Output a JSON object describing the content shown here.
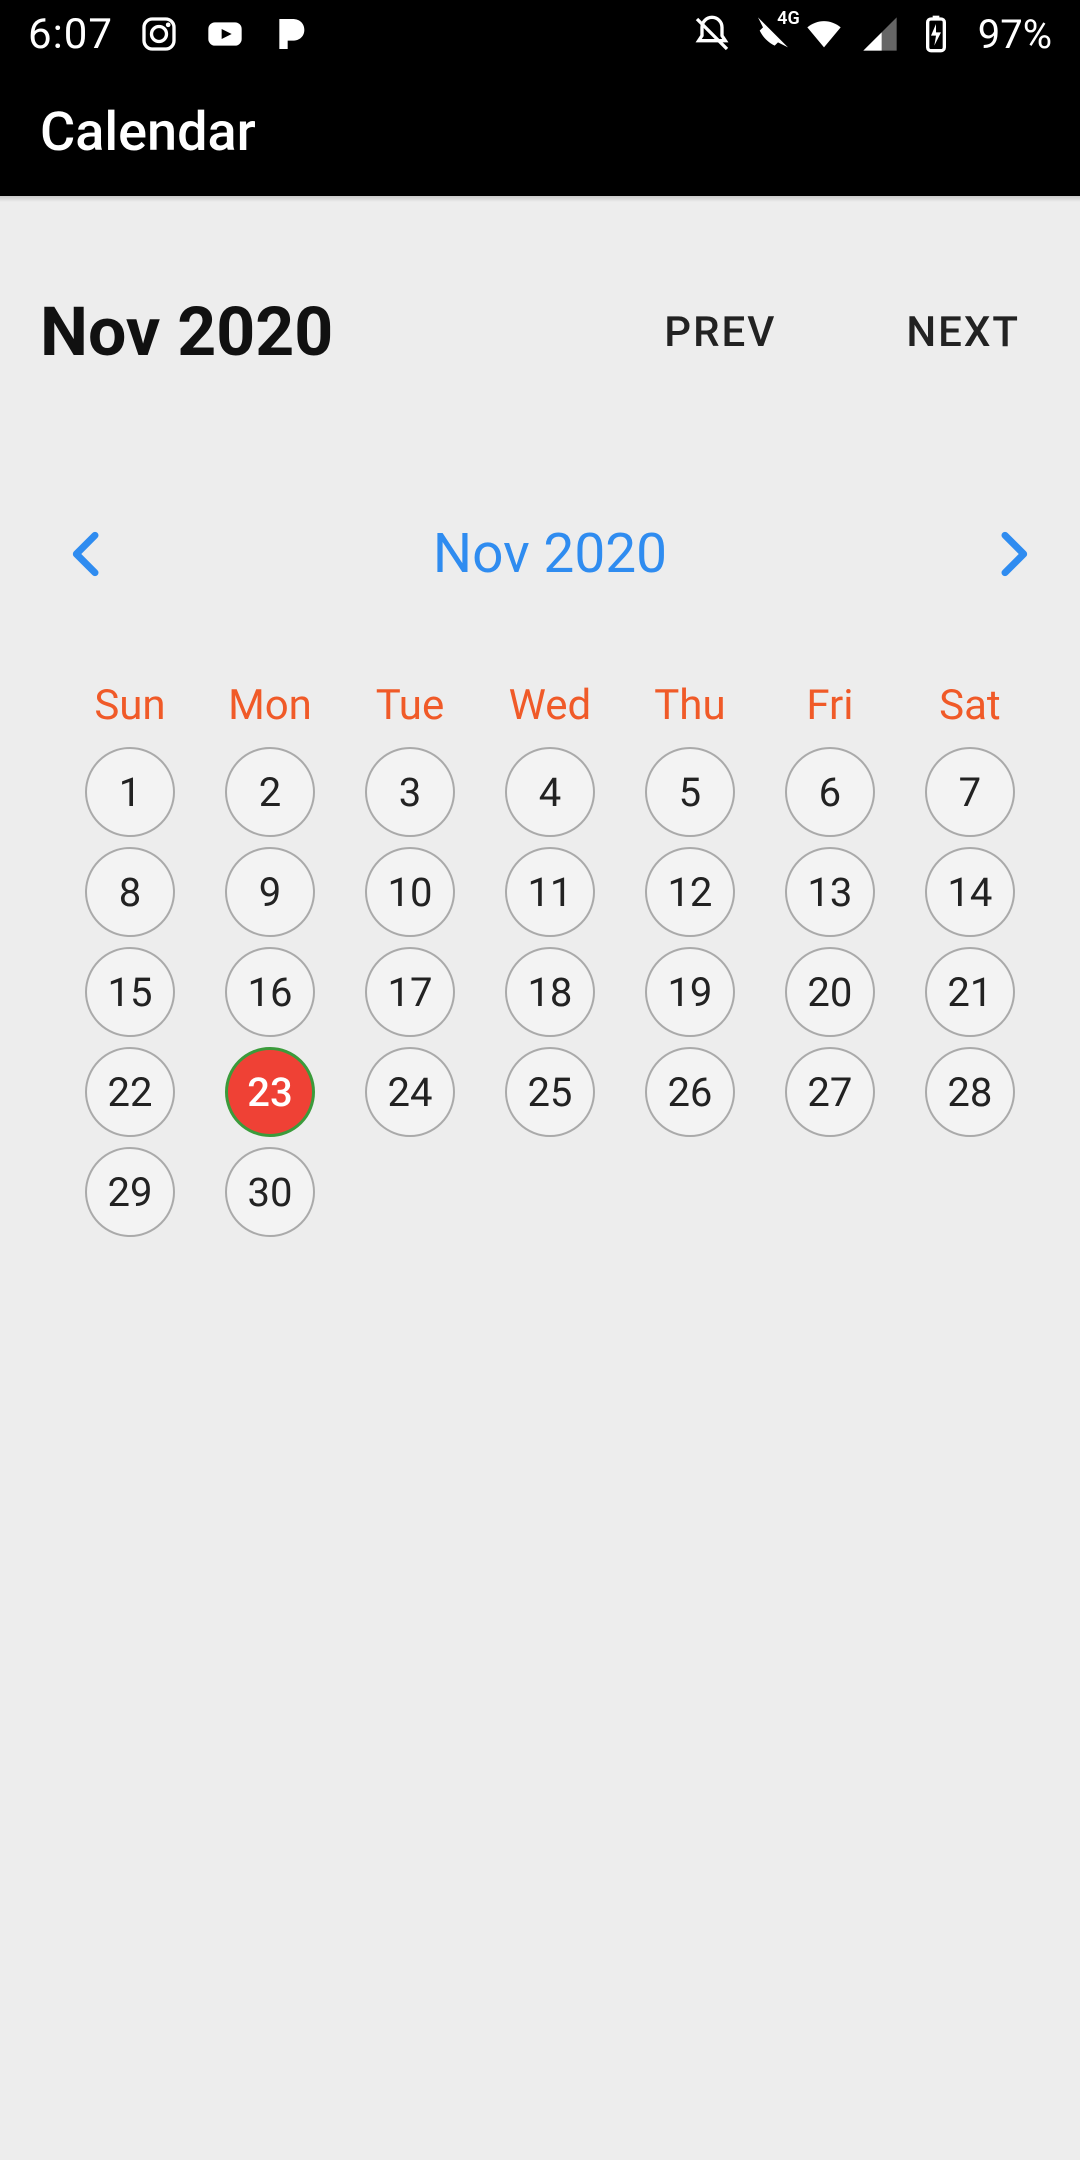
{
  "status": {
    "time": "6:07",
    "battery_pct": "97%",
    "notif_icons": [
      "instagram-icon",
      "youtube-icon",
      "pandora-icon"
    ],
    "system_icons": [
      "do-not-disturb-off-icon",
      "wifi-calling-4g-icon",
      "wifi-icon",
      "cell-signal-icon",
      "battery-charging-icon"
    ]
  },
  "appbar": {
    "title": "Calendar"
  },
  "nav": {
    "month_label": "Nov 2020",
    "prev_label": "PREV",
    "next_label": "NEXT"
  },
  "calendar": {
    "title": "Nov 2020",
    "weekdays": [
      "Sun",
      "Mon",
      "Tue",
      "Wed",
      "Thu",
      "Fri",
      "Sat"
    ],
    "days": [
      1,
      2,
      3,
      4,
      5,
      6,
      7,
      8,
      9,
      10,
      11,
      12,
      13,
      14,
      15,
      16,
      17,
      18,
      19,
      20,
      21,
      22,
      23,
      24,
      25,
      26,
      27,
      28,
      29,
      30
    ],
    "selected_day": 23
  },
  "colors": {
    "accent_blue": "#2f8cf0",
    "accent_orange": "#f05a28",
    "selected_fill": "#ef4135",
    "selected_border": "#3b9b3b"
  }
}
